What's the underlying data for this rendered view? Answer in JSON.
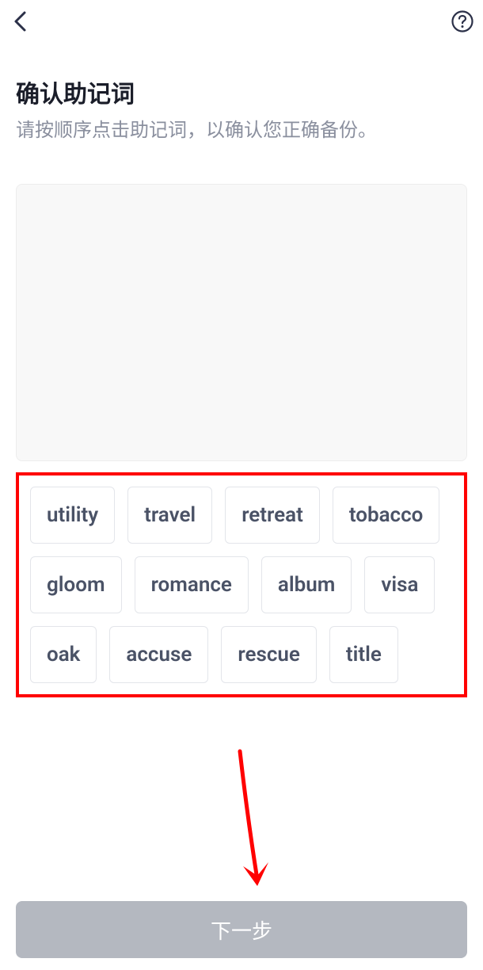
{
  "header": {
    "back_icon": "back",
    "help_icon": "help"
  },
  "title": "确认助记词",
  "subtitle": "请按顺序点击助记词，以确认您正确备份。",
  "words": [
    "utility",
    "travel",
    "retreat",
    "tobacco",
    "gloom",
    "romance",
    "album",
    "visa",
    "oak",
    "accuse",
    "rescue",
    "title"
  ],
  "next_button": "下一步",
  "colors": {
    "highlight_border": "#ff0000",
    "arrow": "#ff0000",
    "button_bg": "#b4b8c0",
    "text_primary": "#1a1d29",
    "text_secondary": "#8a8f9e",
    "chip_text": "#4a5266"
  }
}
